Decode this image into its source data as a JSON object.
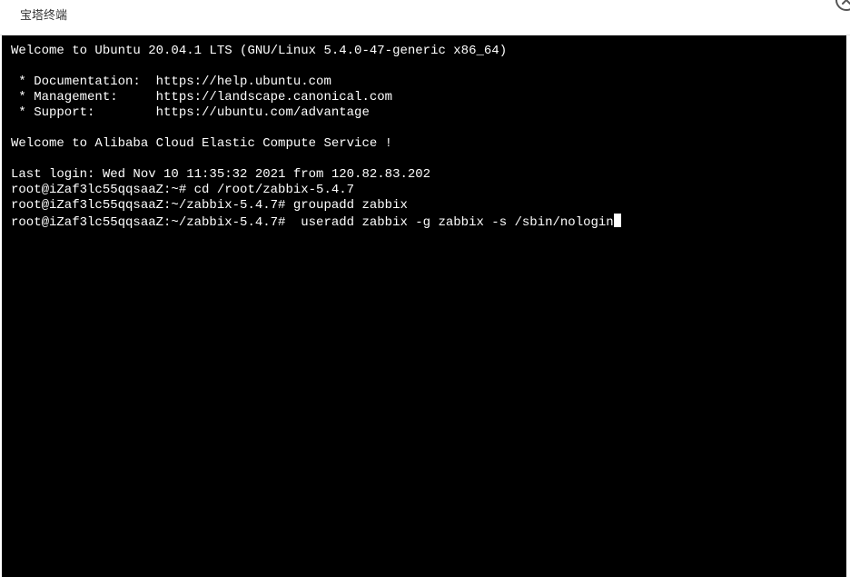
{
  "window": {
    "title": "宝塔终端",
    "close_icon": "close-icon"
  },
  "terminal": {
    "lines": [
      "Welcome to Ubuntu 20.04.1 LTS (GNU/Linux 5.4.0-47-generic x86_64)",
      "",
      " * Documentation:  https://help.ubuntu.com",
      " * Management:     https://landscape.canonical.com",
      " * Support:        https://ubuntu.com/advantage",
      "",
      "Welcome to Alibaba Cloud Elastic Compute Service !",
      "",
      "Last login: Wed Nov 10 11:35:32 2021 from 120.82.83.202",
      "root@iZaf3lc55qqsaaZ:~# cd /root/zabbix-5.4.7",
      "root@iZaf3lc55qqsaaZ:~/zabbix-5.4.7# groupadd zabbix"
    ],
    "current_prompt": "root@iZaf3lc55qqsaaZ:~/zabbix-5.4.7#",
    "current_input": "  useradd zabbix -g zabbix -s /sbin/nologin",
    "colors": {
      "background": "#000000",
      "foreground": "#ffffff"
    }
  }
}
